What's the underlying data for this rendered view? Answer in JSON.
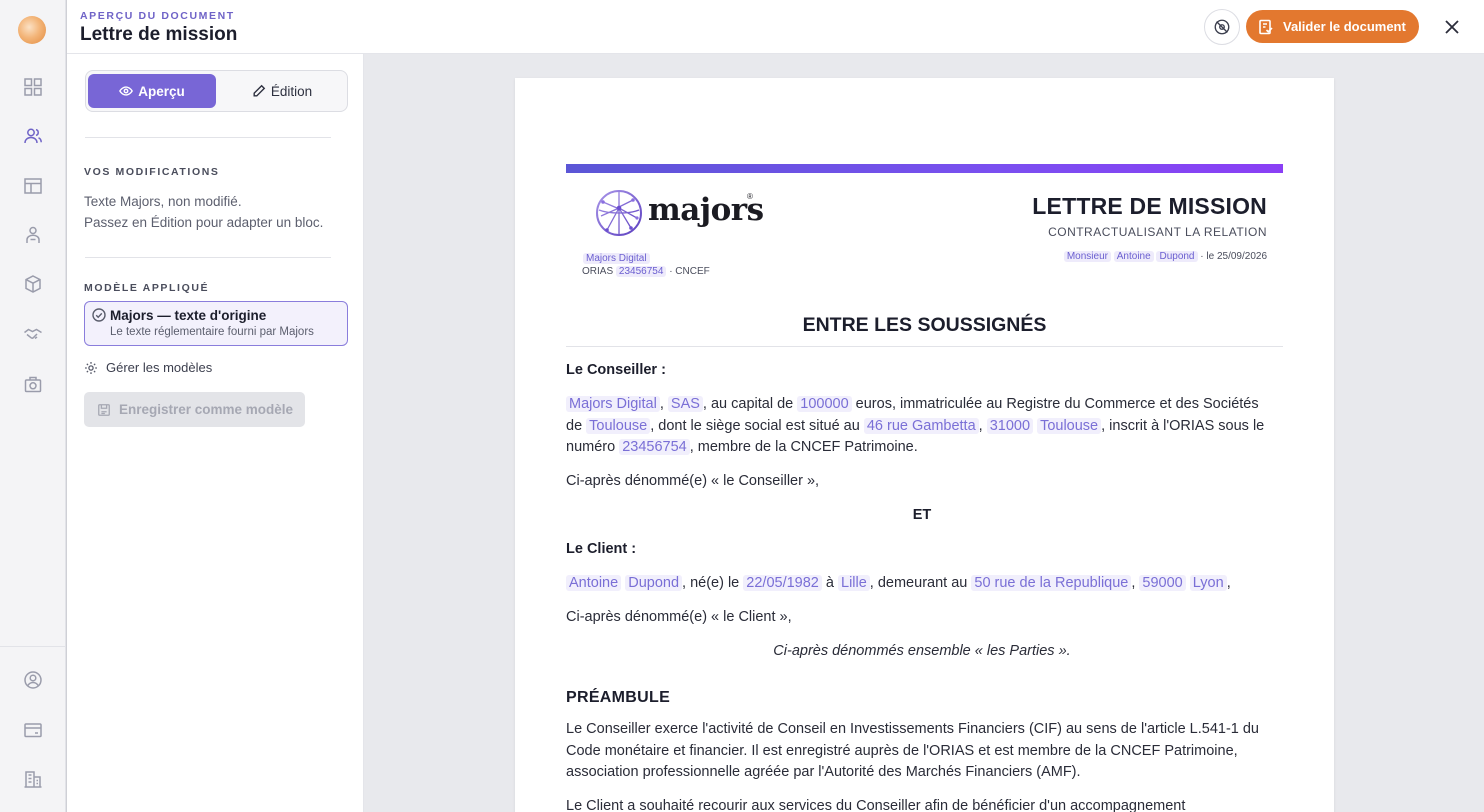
{
  "rail": {
    "top_icons": [
      "dashboard-icon",
      "clients-icon",
      "table-icon",
      "advisor-icon",
      "package-icon",
      "handshake-icon",
      "camera-box-icon"
    ],
    "bottom_icons": [
      "account-icon",
      "billing-icon",
      "building-icon"
    ]
  },
  "header": {
    "eyebrow": "APERÇU DU DOCUMENT",
    "title": "Lettre de mission",
    "validate_label": "Valider le document"
  },
  "panel": {
    "tabs": [
      {
        "label": "Aperçu",
        "active": true
      },
      {
        "label": "Édition",
        "active": false
      }
    ],
    "modifications_title": "VOS MODIFICATIONS",
    "modifications_line1": "Texte Majors, non modifié.",
    "modifications_line2": "Passez en Édition pour adapter un bloc.",
    "model_title": "MODÈLE APPLIQUÉ",
    "model_name": "Majors — texte d'origine",
    "model_desc": "Le texte réglementaire fourni par Majors",
    "manage_label": "Gérer les modèles",
    "save_label": "Enregistrer comme modèle"
  },
  "doc": {
    "brand_word": "majors",
    "brand_reg": "®",
    "company_tag": "Majors Digital",
    "orias_prefix": "ORIAS",
    "orias_number": "23456754",
    "orias_suffix": "· CNCEF",
    "title": "LETTRE DE MISSION",
    "subtitle": "CONTRACTUALISANT LA RELATION",
    "meta_civility": "Monsieur",
    "meta_first": "Antoine",
    "meta_last": "Dupond",
    "meta_date": "· le 25/09/2026",
    "between": "ENTRE LES SOUSSIGNÉS",
    "advisor_heading": "Le Conseiller :",
    "advisor": {
      "name": "Majors Digital",
      "sep1": ",",
      "form": "SAS",
      "t1": ", au capital de",
      "capital": "100000",
      "t2": "euros, immatriculée au Registre du Commerce et des Sociétés de",
      "rcs_city": "Toulouse",
      "t3": ", dont le siège social est situé au",
      "address": "46 rue Gambetta",
      "sep2": ",",
      "zip": "31000",
      "city": "Toulouse",
      "t4": ", inscrit à l'ORIAS sous le numéro",
      "orias": "23456754",
      "t5": ", membre de la CNCEF Patrimoine."
    },
    "advisor_called": "Ci-après dénommé(e) « le Conseiller »,",
    "and": "ET",
    "client_heading": "Le Client :",
    "client": {
      "first": "Antoine",
      "last": "Dupond",
      "t1": ", né(e) le",
      "birth": "22/05/1982",
      "t2": "à",
      "birth_city": "Lille",
      "t3": ", demeurant au",
      "address": "50 rue de la Republique",
      "sep": ",",
      "zip": "59000",
      "city": "Lyon",
      "t4": ","
    },
    "client_called": "Ci-après dénommé(e) « le Client »,",
    "parties": "Ci-après dénommés ensemble « les Parties ».",
    "preamble_title": "PRÉAMBULE",
    "preamble_p1": "Le Conseiller exerce l'activité de Conseil en Investissements Financiers (CIF) au sens de l'article L.541-1 du Code monétaire et financier. Il est enregistré auprès de l'ORIAS et est membre de la CNCEF Patrimoine, association professionnelle agréée par l'Autorité des Marchés Financiers (AMF).",
    "preamble_p2": "Le Client a souhaité recourir aux services du Conseiller afin de bénéficier d'un accompagnement"
  },
  "colors": {
    "accent": "#7866d6",
    "validate": "#e3782f",
    "variable_text": "#7a6fd6",
    "variable_bg": "#f1effc"
  }
}
